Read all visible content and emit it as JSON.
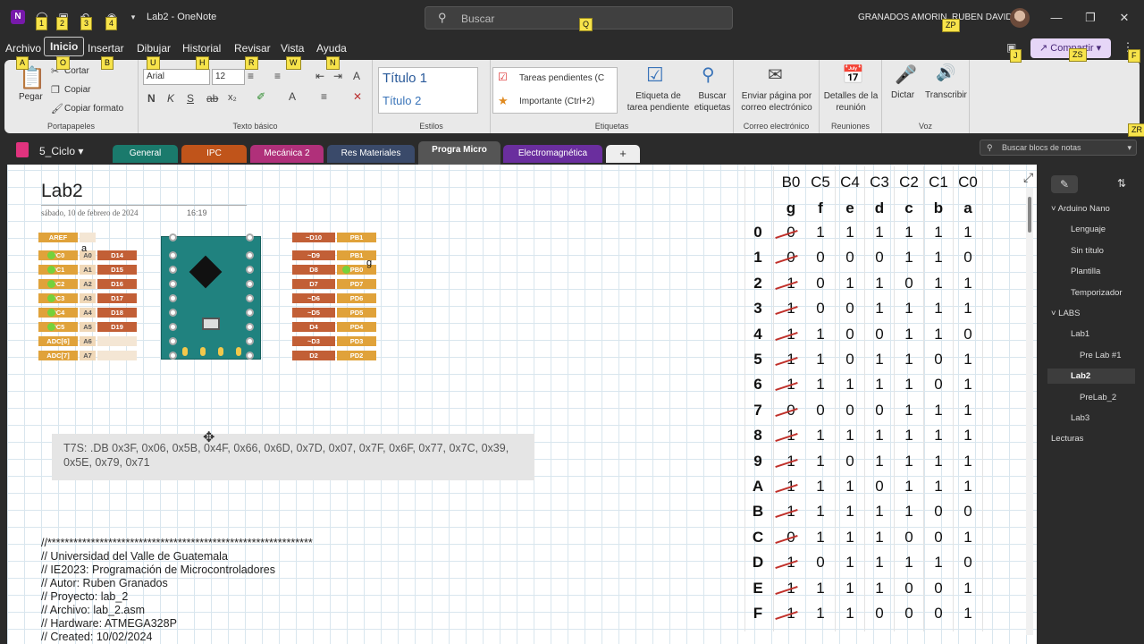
{
  "app": {
    "title": "Lab2 - OneNote",
    "user": "GRANADOS AMORIN, RUBEN DAVID",
    "search_placeholder": "Buscar",
    "share_label": "Compartir"
  },
  "keytips": [
    "1",
    "2",
    "3",
    "4",
    "Q",
    "ZP",
    "A",
    "O",
    "B",
    "U",
    "H",
    "R",
    "W",
    "N",
    "J",
    "ZS",
    "F",
    "ZR"
  ],
  "menu": [
    "Archivo",
    "Inicio",
    "Insertar",
    "Dibujar",
    "Historial",
    "Revisar",
    "Vista",
    "Ayuda"
  ],
  "ribbon": {
    "clipboard": {
      "paste": "Pegar",
      "cut": "Cortar",
      "copy": "Copiar",
      "format_painter": "Copiar formato",
      "group": "Portapapeles"
    },
    "font": {
      "family": "Arial",
      "size": "12",
      "group": "Texto básico"
    },
    "styles": {
      "h1": "Título 1",
      "h2": "Título 2",
      "group": "Estilos"
    },
    "tags": {
      "todo": "Tareas pendientes (C",
      "important": "Importante (Ctrl+2)",
      "todo_tag": "Etiqueta de tarea pendiente",
      "find_tags": "Buscar etiquetas",
      "group": "Etiquetas"
    },
    "email": {
      "label": "Enviar página por correo electrónico",
      "group": "Correo electrónico"
    },
    "meetings": {
      "label": "Detalles de la reunión",
      "group": "Reuniones"
    },
    "voice": {
      "dictate": "Dictar",
      "transcribe": "Transcribir",
      "group": "Voz"
    }
  },
  "notebook": {
    "name": "5_Ciclo",
    "search_placeholder": "Buscar blocs de notas",
    "sections": [
      {
        "label": "General",
        "color": "#1a7a6c"
      },
      {
        "label": "IPC",
        "color": "#c0541a"
      },
      {
        "label": "Mecánica 2",
        "color": "#b0307a"
      },
      {
        "label": "Res Materiales",
        "color": "#3a4a6a"
      },
      {
        "label": "Progra Micro",
        "color": "#555555"
      },
      {
        "label": "Electromagnética",
        "color": "#6a2e9e"
      }
    ]
  },
  "page": {
    "title": "Lab2",
    "date": "sábado, 10 de febrero de 2024",
    "time": "16:19",
    "code_line": "T7S: .DB 0x3F, 0x06, 0x5B, 0x4F, 0x66, 0x6D, 0x7D, 0x07, 0x7F, 0x6F, 0x77, 0x7C, 0x39, 0x5E, 0x79, 0x71",
    "header_comment": "//*************************************************************\n// Universidad del Valle de Guatemala\n// IE2023: Programación de Microcontroladores\n// Autor: Ruben Granados\n// Proyecto: lab_2\n// Archivo: lab_2.asm\n// Hardware: ATMEGA328P\n// Created: 10/02/2024"
  },
  "arduino": {
    "left_pins": [
      [
        "AREF",
        ""
      ],
      [
        "PC0",
        "A0",
        "D14"
      ],
      [
        "PC1",
        "A1",
        "D15"
      ],
      [
        "PC2",
        "A2",
        "D16"
      ],
      [
        "PC3",
        "A3",
        "D17"
      ],
      [
        "PC4",
        "A4",
        "D18"
      ],
      [
        "PC5",
        "A5",
        "D19"
      ],
      [
        "ADC[6]",
        "A6",
        ""
      ],
      [
        "ADC[7]",
        "A7",
        ""
      ]
    ],
    "right_pins": [
      [
        "~D10",
        "PB1"
      ],
      [
        "~D9",
        "PB1"
      ],
      [
        "D8",
        "PB0"
      ],
      [
        "D7",
        "PD7"
      ],
      [
        "~D6",
        "PD6"
      ],
      [
        "~D5",
        "PD5"
      ],
      [
        "D4",
        "PD4"
      ],
      [
        "~D3",
        "PD3"
      ],
      [
        "D2",
        "PD2"
      ]
    ],
    "annot_a": "a",
    "annot_g": "g"
  },
  "truth_table": {
    "headers_bits": [
      "B0",
      "C5",
      "C4",
      "C3",
      "C2",
      "C1",
      "C0"
    ],
    "headers_segs": [
      "g",
      "f",
      "e",
      "d",
      "c",
      "b",
      "a"
    ],
    "rows": [
      {
        "digit": "0",
        "bits": [
          "0",
          "1",
          "1",
          "1",
          "1",
          "1",
          "1"
        ]
      },
      {
        "digit": "1",
        "bits": [
          "0",
          "0",
          "0",
          "0",
          "1",
          "1",
          "0"
        ]
      },
      {
        "digit": "2",
        "bits": [
          "1",
          "0",
          "1",
          "1",
          "0",
          "1",
          "1"
        ]
      },
      {
        "digit": "3",
        "bits": [
          "1",
          "0",
          "0",
          "1",
          "1",
          "1",
          "1"
        ]
      },
      {
        "digit": "4",
        "bits": [
          "1",
          "1",
          "0",
          "0",
          "1",
          "1",
          "0"
        ]
      },
      {
        "digit": "5",
        "bits": [
          "1",
          "1",
          "0",
          "1",
          "1",
          "0",
          "1"
        ]
      },
      {
        "digit": "6",
        "bits": [
          "1",
          "1",
          "1",
          "1",
          "1",
          "0",
          "1"
        ]
      },
      {
        "digit": "7",
        "bits": [
          "0",
          "0",
          "0",
          "0",
          "1",
          "1",
          "1"
        ]
      },
      {
        "digit": "8",
        "bits": [
          "1",
          "1",
          "1",
          "1",
          "1",
          "1",
          "1"
        ]
      },
      {
        "digit": "9",
        "bits": [
          "1",
          "1",
          "0",
          "1",
          "1",
          "1",
          "1"
        ]
      },
      {
        "digit": "A",
        "bits": [
          "1",
          "1",
          "1",
          "0",
          "1",
          "1",
          "1"
        ]
      },
      {
        "digit": "B",
        "bits": [
          "1",
          "1",
          "1",
          "1",
          "1",
          "0",
          "0"
        ]
      },
      {
        "digit": "C",
        "bits": [
          "0",
          "1",
          "1",
          "1",
          "0",
          "0",
          "1"
        ]
      },
      {
        "digit": "D",
        "bits": [
          "1",
          "0",
          "1",
          "1",
          "1",
          "1",
          "0"
        ]
      },
      {
        "digit": "E",
        "bits": [
          "1",
          "1",
          "1",
          "1",
          "0",
          "0",
          "1"
        ]
      },
      {
        "digit": "F",
        "bits": [
          "1",
          "1",
          "1",
          "0",
          "0",
          "0",
          "1"
        ]
      }
    ]
  },
  "pages_panel": [
    {
      "label": "Arduino Nano",
      "level": 0,
      "group": true
    },
    {
      "label": "Lenguaje",
      "level": 1
    },
    {
      "label": "Sin título",
      "level": 1
    },
    {
      "label": "Plantilla",
      "level": 1
    },
    {
      "label": "Temporizador",
      "level": 1
    },
    {
      "label": "LABS",
      "level": 0,
      "group": true
    },
    {
      "label": "Lab1",
      "level": 1
    },
    {
      "label": "Pre Lab #1",
      "level": 2
    },
    {
      "label": "Lab2",
      "level": 1,
      "selected": true
    },
    {
      "label": "PreLab_2",
      "level": 2
    },
    {
      "label": "Lab3",
      "level": 1
    },
    {
      "label": "Lecturas",
      "level": 0
    }
  ]
}
